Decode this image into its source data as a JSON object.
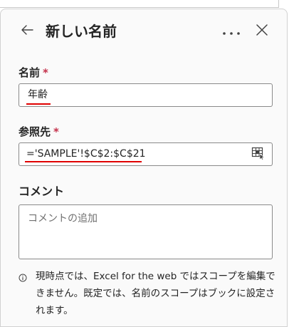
{
  "panel": {
    "title": "新しい名前",
    "back_icon": "arrow-left-icon",
    "more_icon": "more-horizontal-icon",
    "close_icon": "close-icon"
  },
  "name_field": {
    "label": "名前",
    "required_mark": "*",
    "value": "年齢"
  },
  "reference_field": {
    "label": "参照先",
    "required_mark": "*",
    "value": "='SAMPLE'!$C$2:$C$21",
    "picker_icon": "range-select-icon"
  },
  "comment_field": {
    "label": "コメント",
    "placeholder": "コメントの追加",
    "value": ""
  },
  "note": {
    "icon": "info-icon",
    "text": "現時点では、Excel for the web ではスコープを編集できません。既定では、名前のスコープはブックに設定されます。"
  },
  "colors": {
    "required": "#c4314b",
    "error_underline": "#e00000",
    "panel_background": "#fafafa",
    "input_border": "#8a8a8a"
  }
}
